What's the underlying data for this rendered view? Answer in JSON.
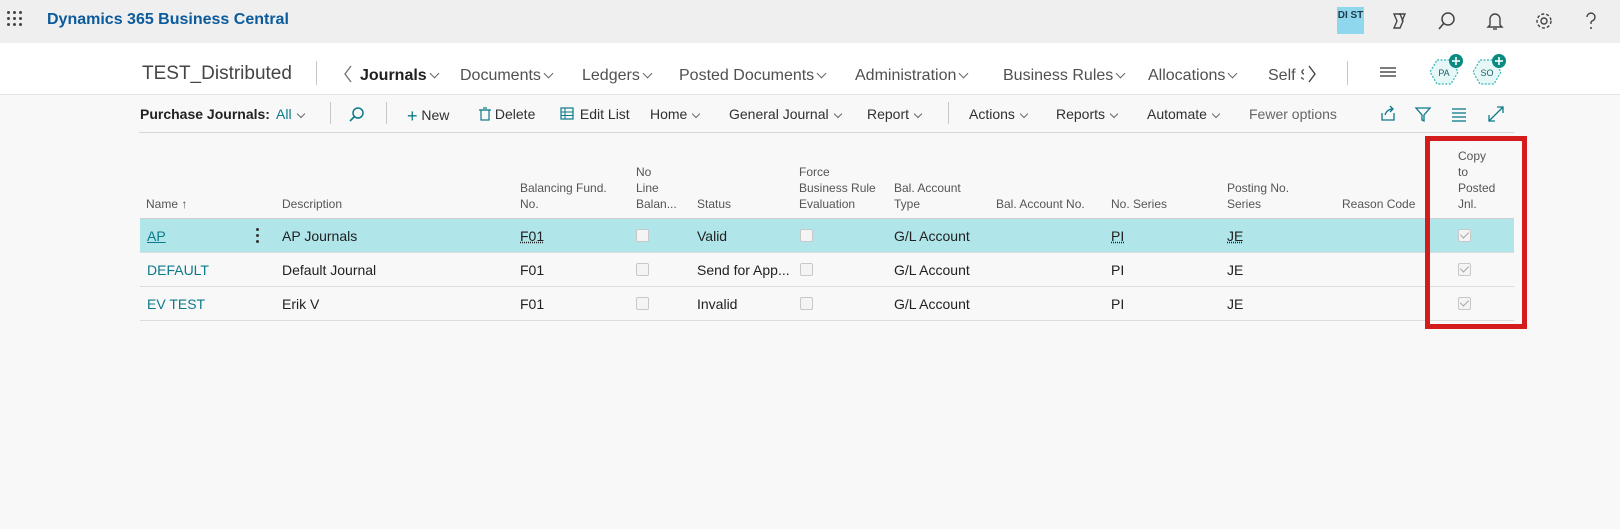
{
  "app": {
    "title": "Dynamics 365 Business Central",
    "user_initials": "DI ST"
  },
  "page": {
    "company": "TEST_Distributed",
    "nav": [
      "Journals",
      "Documents",
      "Ledgers",
      "Posted Documents",
      "Administration",
      "Business Rules",
      "Allocations",
      "Self S"
    ],
    "avatars": [
      "PA",
      "SO"
    ]
  },
  "actionbar": {
    "filter_label": "Purchase Journals:",
    "filter_value": "All",
    "new": "New",
    "delete": "Delete",
    "edit_list": "Edit List",
    "home": "Home",
    "general_journal": "General Journal",
    "report": "Report",
    "actions": "Actions",
    "reports": "Reports",
    "automate": "Automate",
    "fewer_options": "Fewer options"
  },
  "table": {
    "headers": {
      "name": "Name",
      "sort": "↑",
      "description": "Description",
      "balancing_fund": [
        "Balancing Fund.",
        "No."
      ],
      "no_line_balance": [
        "No",
        "Line",
        "Balan..."
      ],
      "status": "Status",
      "force_rule": [
        "Force",
        "Business Rule",
        "Evaluation"
      ],
      "bal_account_type": [
        "Bal. Account",
        "Type"
      ],
      "bal_account_no": "Bal. Account No.",
      "no_series": "No. Series",
      "posting_no_series": [
        "Posting No.",
        "Series"
      ],
      "reason_code": "Reason Code",
      "copy_to_posted": [
        "Copy",
        "to",
        "Posted",
        "Jnl."
      ]
    },
    "rows": [
      {
        "name": "AP",
        "description": "AP Journals",
        "fund": "F01",
        "no_line_bal": false,
        "status": "Valid",
        "force_rule": false,
        "bal_type": "G/L Account",
        "bal_no": "",
        "no_series": "PI",
        "posting_series": "JE",
        "reason_code": "",
        "copy_posted": true
      },
      {
        "name": "DEFAULT",
        "description": "Default Journal",
        "fund": "F01",
        "no_line_bal": false,
        "status": "Send for App...",
        "force_rule": false,
        "bal_type": "G/L Account",
        "bal_no": "",
        "no_series": "PI",
        "posting_series": "JE",
        "reason_code": "",
        "copy_posted": true
      },
      {
        "name": "EV TEST",
        "description": "Erik V",
        "fund": "F01",
        "no_line_bal": false,
        "status": "Invalid",
        "force_rule": false,
        "bal_type": "G/L Account",
        "bal_no": "",
        "no_series": "PI",
        "posting_series": "JE",
        "reason_code": "",
        "copy_posted": true
      }
    ]
  }
}
